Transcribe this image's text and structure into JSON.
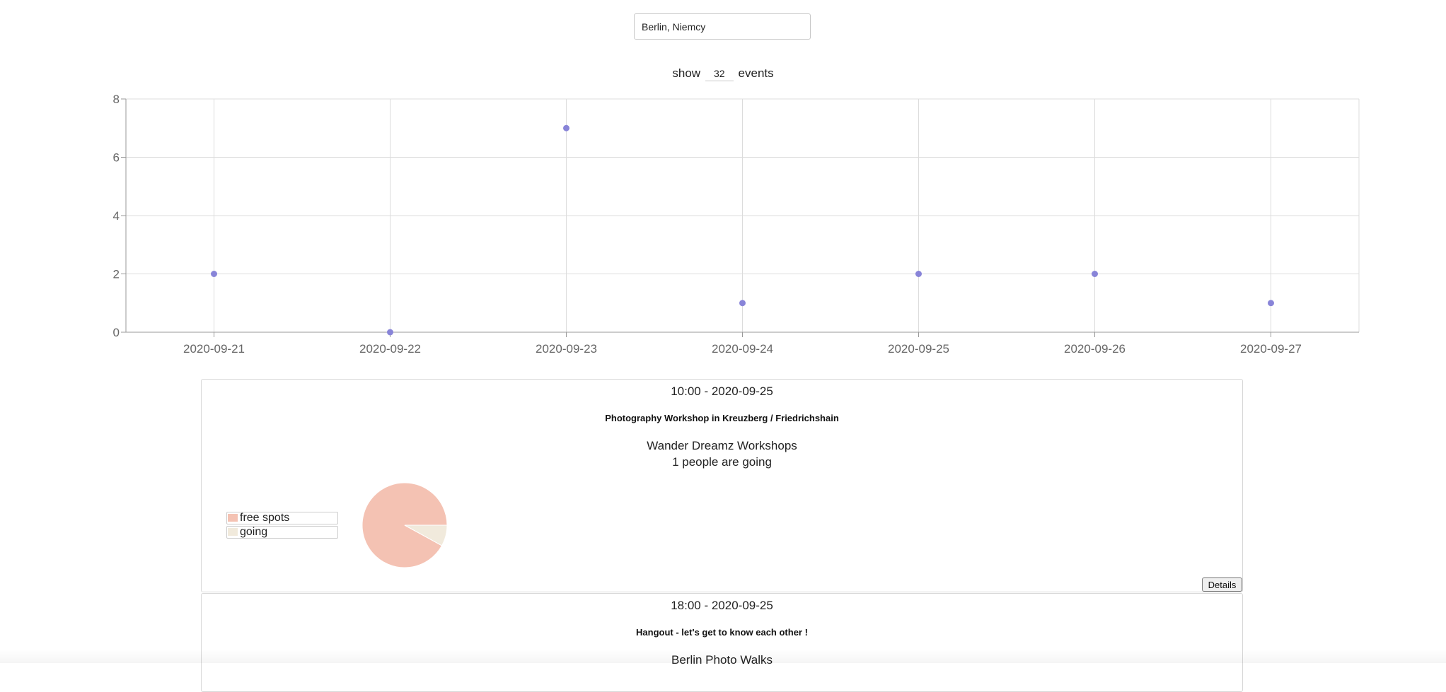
{
  "search": {
    "value": "Berlin, Niemcy"
  },
  "show_events": {
    "prefix": "show",
    "count": "32",
    "suffix": "events"
  },
  "chart_data": {
    "type": "scatter",
    "x": [
      "2020-09-21",
      "2020-09-22",
      "2020-09-23",
      "2020-09-24",
      "2020-09-25",
      "2020-09-26",
      "2020-09-27"
    ],
    "y": [
      2,
      0,
      7,
      1,
      2,
      2,
      1
    ],
    "yticks": [
      0,
      2,
      4,
      6,
      8
    ],
    "ylim": [
      0,
      8
    ],
    "grid": true,
    "point_color": "#8884d8"
  },
  "events": [
    {
      "time": "10:00 - 2020-09-25",
      "title": "Photography Workshop in Kreuzberg / Friedrichshain",
      "group": "Wander Dreamz Workshops",
      "going_text": "1 people are going",
      "legend": [
        {
          "label": "free spots",
          "color": "#f4c2b3"
        },
        {
          "label": "going",
          "color": "#f1eadc"
        }
      ],
      "pie": {
        "going_fraction": 0.08
      },
      "details_label": "Details"
    },
    {
      "time": "18:00 - 2020-09-25",
      "title": "Hangout - let's get to know each other !",
      "group": "Berlin Photo Walks"
    }
  ]
}
